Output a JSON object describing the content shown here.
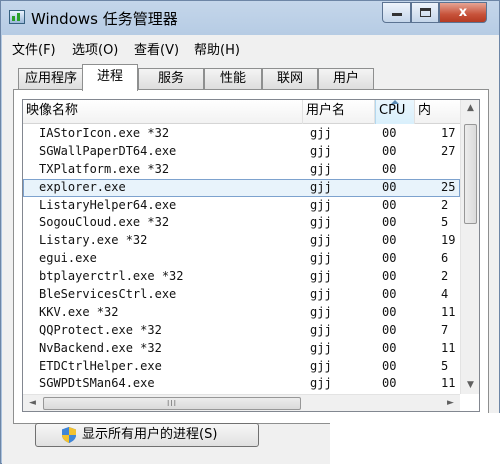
{
  "window": {
    "title": "Windows 任务管理器",
    "min_label": "",
    "max_label": "",
    "close_label": "x"
  },
  "menu": [
    "文件(F)",
    "选项(O)",
    "查看(V)",
    "帮助(H)"
  ],
  "tabs": [
    "应用程序",
    "进程",
    "服务",
    "性能",
    "联网",
    "用户"
  ],
  "active_tab": "进程",
  "columns": {
    "name": "映像名称",
    "user": "用户名",
    "cpu": "CPU",
    "mem": "内"
  },
  "processes": [
    {
      "name": "IAStorIcon.exe *32",
      "user": "gjj",
      "cpu": "00",
      "mem": "17"
    },
    {
      "name": "SGWallPaperDT64.exe",
      "user": "gjj",
      "cpu": "00",
      "mem": "27"
    },
    {
      "name": "TXPlatform.exe *32",
      "user": "gjj",
      "cpu": "00",
      "mem": ""
    },
    {
      "name": "explorer.exe",
      "user": "gjj",
      "cpu": "00",
      "mem": "25"
    },
    {
      "name": "ListaryHelper64.exe",
      "user": "gjj",
      "cpu": "00",
      "mem": "2"
    },
    {
      "name": "SogouCloud.exe *32",
      "user": "gjj",
      "cpu": "00",
      "mem": "5"
    },
    {
      "name": "Listary.exe *32",
      "user": "gjj",
      "cpu": "00",
      "mem": "19"
    },
    {
      "name": "egui.exe",
      "user": "gjj",
      "cpu": "00",
      "mem": "6"
    },
    {
      "name": "btplayerctrl.exe *32",
      "user": "gjj",
      "cpu": "00",
      "mem": "2"
    },
    {
      "name": "BleServicesCtrl.exe",
      "user": "gjj",
      "cpu": "00",
      "mem": "4"
    },
    {
      "name": "KKV.exe *32",
      "user": "gjj",
      "cpu": "00",
      "mem": "11"
    },
    {
      "name": "QQProtect.exe *32",
      "user": "gjj",
      "cpu": "00",
      "mem": "7"
    },
    {
      "name": "NvBackend.exe *32",
      "user": "gjj",
      "cpu": "00",
      "mem": "11"
    },
    {
      "name": "ETDCtrlHelper.exe",
      "user": "gjj",
      "cpu": "00",
      "mem": "5"
    },
    {
      "name": "SGWPDtSMan64.exe",
      "user": "gjj",
      "cpu": "00",
      "mem": "11"
    }
  ],
  "selected_process": "explorer.exe",
  "scroll": {
    "up": "▲",
    "down": "▼",
    "left": "◄",
    "right": "►",
    "grip_v": "",
    "grip_h": "III"
  },
  "show_all_button": "显示所有用户的进程(S)",
  "colors": {
    "accent": "#7da2ce",
    "window_frame": "#b4cae3",
    "close_button": "#c7523a"
  }
}
